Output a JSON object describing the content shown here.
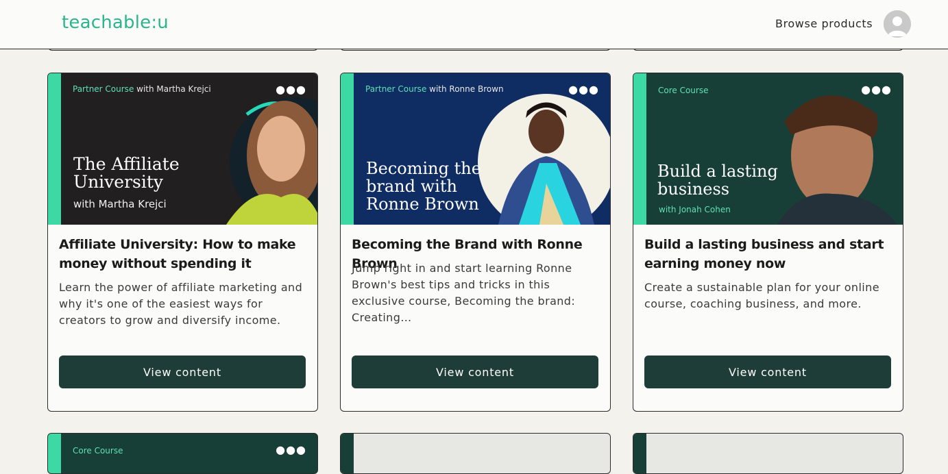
{
  "header": {
    "logo": "teachable:u",
    "browse": "Browse products"
  },
  "cards": [
    {
      "kicker_accent": "Partner Course",
      "kicker_rest": " with Martha Krejci",
      "thumb_title_1": "The Affiliate",
      "thumb_title_2": "University",
      "thumb_sub": "with Martha Krejci",
      "title": "Affiliate University: How to make money without spending it",
      "description": "Learn the power of affiliate marketing and why it's one of the easiest ways for creators to grow and diversify income.",
      "button": "View content"
    },
    {
      "kicker_accent": "Partner Course",
      "kicker_rest": " with Ronne Brown",
      "thumb_title_1": "Becoming the",
      "thumb_title_2": "brand with",
      "thumb_title_3": "Ronne Brown",
      "title": "Becoming the Brand with Ronne Brown",
      "description": "Jump right in and start learning Ronne Brown's best tips and tricks in this exclusive course, Becoming the brand: Creating…",
      "button": "View content"
    },
    {
      "kicker_accent": "Core Course",
      "thumb_title_1": "Build a lasting",
      "thumb_title_2": "business",
      "thumb_sub": "with Jonah Cohen",
      "title": "Build a lasting business and start earning money now",
      "description": "Create a sustainable plan for your online course, coaching business, and more.",
      "button": "View content"
    }
  ],
  "peek": {
    "kicker": "Core Course"
  },
  "colors": {
    "brand": "#2bb58b",
    "button": "#1e3d38",
    "accent_strip": "#3dd9a4"
  }
}
